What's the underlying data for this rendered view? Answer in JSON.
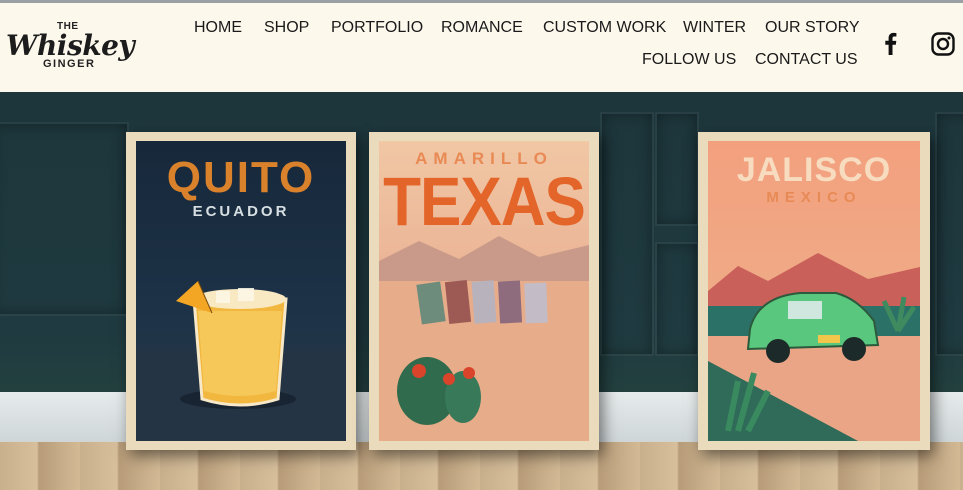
{
  "logo": {
    "the": "THE",
    "script": "Whiskey",
    "ginger": "GINGER"
  },
  "nav": {
    "home": "HOME",
    "shop": "SHOP",
    "portfolio": "PORTFOLIO",
    "romance": "ROMANCE",
    "custom_work": "CUSTOM WORK",
    "winter": "WINTER",
    "our_story": "OUR STORY",
    "follow_us": "FOLLOW US",
    "contact_us": "CONTACT US"
  },
  "social": {
    "facebook_icon": "facebook-icon",
    "instagram_icon": "instagram-icon"
  },
  "posters": [
    {
      "title": "QUITO",
      "subtitle": "ECUADOR"
    },
    {
      "title": "TEXAS",
      "subtitle": "AMARILLO"
    },
    {
      "title": "JALISCO",
      "subtitle": "MEXICO"
    }
  ],
  "colors": {
    "header_bg": "#fcf8ec",
    "wall": "#1f3a40",
    "quito_title": "#d9822b",
    "texas_title": "#e4652a",
    "jalisco_title": "#f7dcc0"
  }
}
